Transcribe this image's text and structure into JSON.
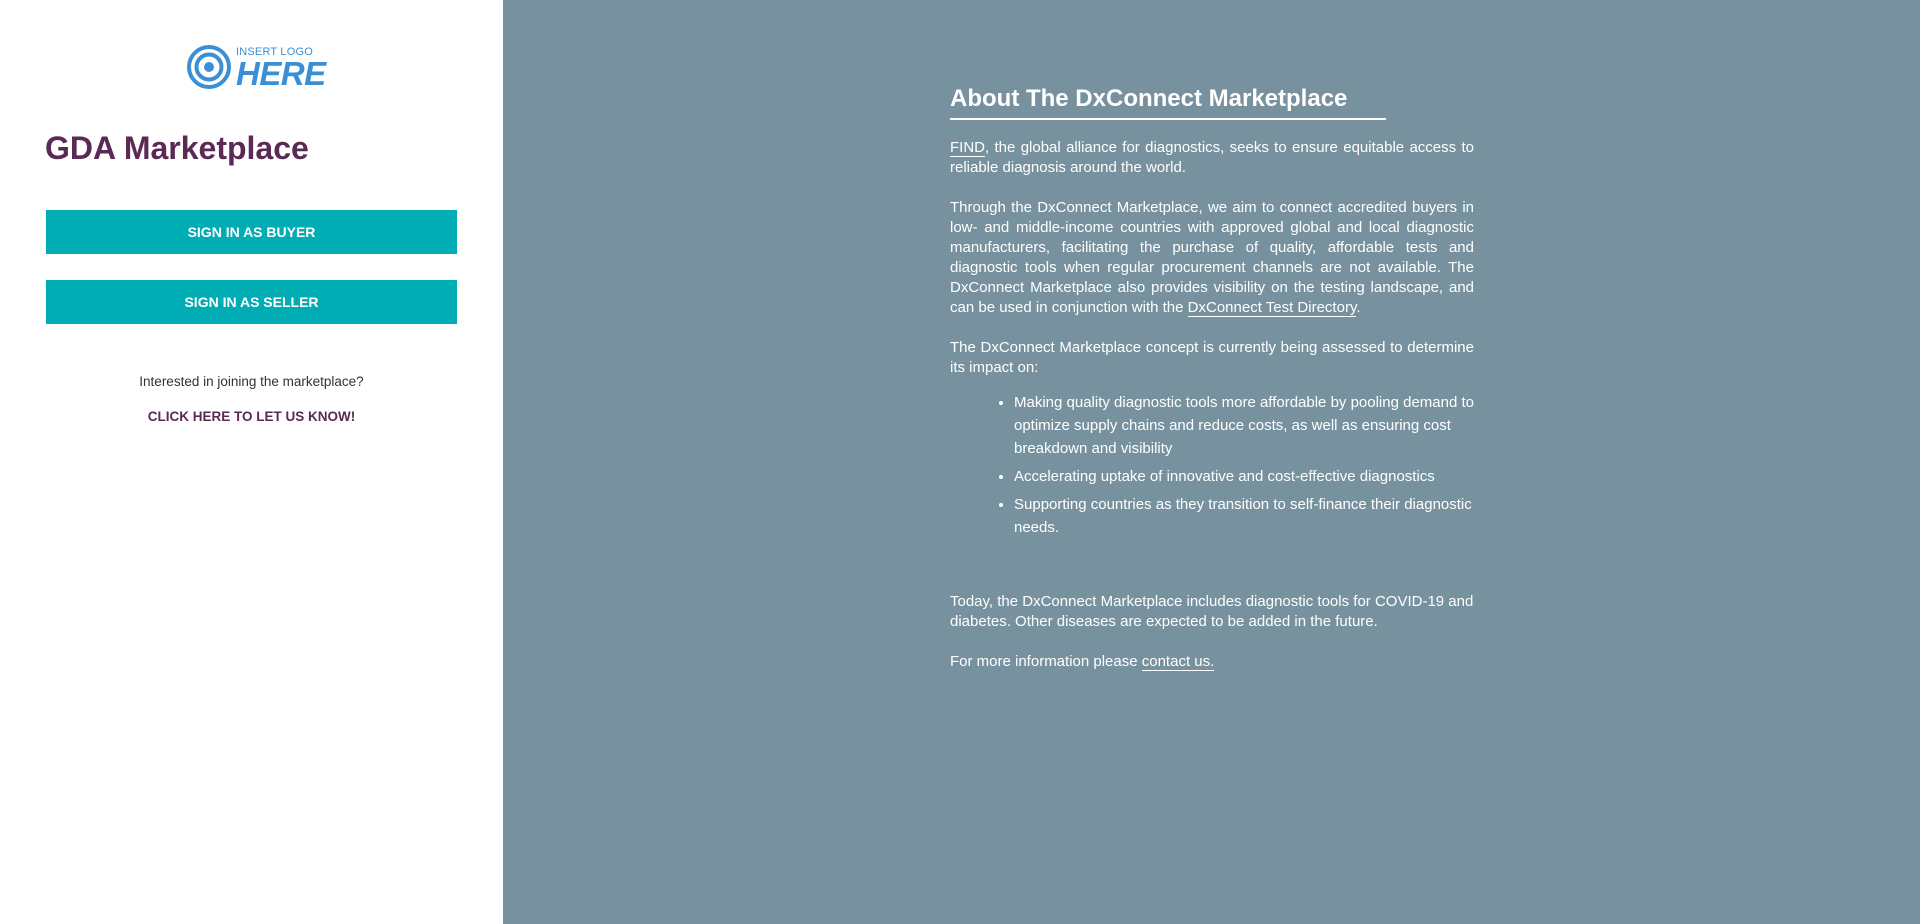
{
  "left_panel": {
    "logo": {
      "small_text": "INSERT LOGO",
      "big_text": "HERE",
      "color": "#3a8fd6"
    },
    "title": "GDA Marketplace",
    "buyer_button": "SIGN IN AS BUYER",
    "seller_button": "SIGN IN AS SELLER",
    "interest_text": "Interested in joining the marketplace?",
    "cta_link": "CLICK HERE TO LET US KNOW!"
  },
  "about": {
    "heading": "About The DxConnect Marketplace",
    "p1": {
      "link": "FIND",
      "text": ", the global alliance for diagnostics, seeks to ensure equitable access to reliable diagnosis around the world."
    },
    "p2": {
      "text": "Through the DxConnect Marketplace, we aim to connect accredited buyers in low- and middle-income countries with approved global and local diagnostic manufacturers, facilitating the purchase of quality, affordable tests and diagnostic tools when regular procurement channels are not available. The DxConnect Marketplace also provides visibility on the testing landscape, and can be used in conjunction with the ",
      "link": "DxConnect Test Directory",
      "end": "."
    },
    "p3": "The DxConnect Marketplace concept is currently being assessed to determine its impact on:",
    "bullets": [
      "Making quality diagnostic tools more affordable by pooling demand to optimize supply chains and reduce costs, as well as ensuring cost breakdown and visibility",
      "Accelerating uptake of innovative and cost-effective diagnostics",
      "Supporting countries as they transition to self-finance their diagnostic needs."
    ],
    "p4": "Today, the DxConnect Marketplace includes diagnostic tools for COVID-19 and diabetes. Other diseases are expected to be added in the future.",
    "p5": {
      "text": "For more information please ",
      "link": "contact us."
    }
  },
  "colors": {
    "left_bg": "#ffffff",
    "right_bg": "#77929e",
    "button": "#00adb5",
    "title": "#5a2a55"
  }
}
